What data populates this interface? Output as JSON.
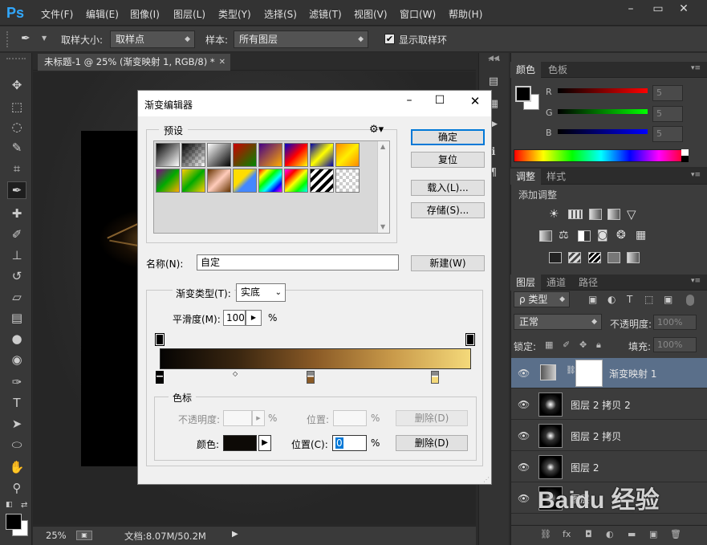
{
  "app": {
    "logo": "Ps"
  },
  "menu": [
    "文件(F)",
    "编辑(E)",
    "图像(I)",
    "图层(L)",
    "类型(Y)",
    "选择(S)",
    "滤镜(T)",
    "视图(V)",
    "窗口(W)",
    "帮助(H)"
  ],
  "window_controls": [
    "minimize-icon",
    "restore-icon",
    "close-icon"
  ],
  "options": {
    "sample_size_label": "取样大小:",
    "sample_size_value": "取样点",
    "sample_label": "样本:",
    "sample_value": "所有图层",
    "show_ring_label": "显示取样环",
    "show_ring_checked": true
  },
  "tools": [
    "move-icon",
    "marquee-icon",
    "lasso-icon",
    "quick-select-icon",
    "crop-icon",
    "eyedropper-icon",
    "healing-icon",
    "brush-icon",
    "stamp-icon",
    "history-brush-icon",
    "eraser-icon",
    "gradient-icon",
    "blur-icon",
    "dodge-icon",
    "pen-icon",
    "type-icon",
    "path-select-icon",
    "ellipse-icon",
    "hand-icon",
    "zoom-icon"
  ],
  "document": {
    "tab_title": "未标题-1 @ 25% (渐变映射 1, RGB/8) *",
    "zoom": "25%",
    "doc_info": "文档:8.07M/50.2M"
  },
  "color_panel": {
    "tabs": [
      "颜色",
      "色板"
    ],
    "channels": [
      {
        "label": "R",
        "value": "5",
        "color": "#ff0000"
      },
      {
        "label": "G",
        "value": "5",
        "color": "#00ff00"
      },
      {
        "label": "B",
        "value": "5",
        "color": "#0000ff"
      }
    ]
  },
  "adjustments_panel": {
    "tabs": [
      "调整",
      "样式"
    ],
    "title": "添加调整"
  },
  "layers_panel": {
    "tabs": [
      "图层",
      "通道",
      "路径"
    ],
    "filter_value": "ρ 类型",
    "blend_mode": "正常",
    "opacity_label": "不透明度:",
    "opacity_value": "100%",
    "lock_label": "锁定:",
    "fill_label": "填充:",
    "fill_value": "100%",
    "layers": [
      {
        "name": "渐变映射 1",
        "selected": true
      },
      {
        "name": "图层 2 拷贝 2",
        "selected": false
      },
      {
        "name": "图层 2 拷贝",
        "selected": false
      },
      {
        "name": "图层 2",
        "selected": false
      },
      {
        "name": "图层",
        "selected": false
      }
    ]
  },
  "watermark": "Baidu 经验",
  "dialog": {
    "title": "渐变编辑器",
    "presets_label": "预设",
    "buttons": {
      "ok": "确定",
      "reset": "复位",
      "load": "载入(L)...",
      "save": "存储(S)...",
      "new": "新建(W)"
    },
    "name_label": "名称(N):",
    "name_value": "自定",
    "gradient_type_label": "渐变类型(T):",
    "gradient_type_value": "实底",
    "smoothness_label": "平滑度(M):",
    "smoothness_value": "100",
    "smoothness_unit": "%",
    "gradient_colors": [
      "#050403",
      "#3a2610",
      "#8a5a26",
      "#c99a4a",
      "#f4d97a"
    ],
    "color_stops_label": "色标",
    "stop_opacity_label": "不透明度:",
    "stop_location_label": "位置:",
    "delete_label": "删除(D)",
    "color_label": "颜色:",
    "color_location_label": "位置(C):",
    "color_location_value": "0",
    "percent": "%",
    "color_swatch": "#0d0a06"
  }
}
